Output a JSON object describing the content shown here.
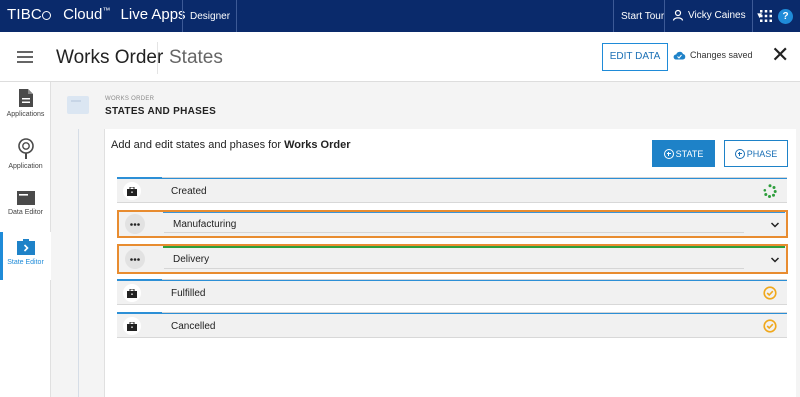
{
  "topbar": {
    "brand_tibco": "TIBC",
    "brand_cloud": "Cloud",
    "brand_tm": "™",
    "brand_app": "Live Apps",
    "designer_label": "Designer",
    "start_tour_label": "Start Tour",
    "user_name": "Vicky Caines",
    "help_label": "?"
  },
  "header": {
    "title": "Works Order",
    "subtitle": "States",
    "edit_data_label": "EDIT DATA",
    "save_status": "Changes saved",
    "close_label": "✕"
  },
  "sidebar": {
    "items": [
      {
        "label": "Applications",
        "icon": "document-icon"
      },
      {
        "label": "Application",
        "icon": "lightbulb-icon"
      },
      {
        "label": "Data Editor",
        "icon": "card-icon"
      },
      {
        "label": "State Editor",
        "icon": "state-icon"
      }
    ]
  },
  "content": {
    "eyebrow": "WORKS ORDER",
    "section_title": "STATES AND PHASES",
    "intro_prefix": "Add and edit states and phases for ",
    "intro_bold": "Works Order",
    "add_state_label": "STATE",
    "add_phase_label": "PHASE"
  },
  "rows": [
    {
      "name": "Created",
      "kind": "state",
      "status": "in-progress"
    },
    {
      "name": "Manufacturing",
      "kind": "phase",
      "status": "expand"
    },
    {
      "name": "Delivery",
      "kind": "phase",
      "status": "expand"
    },
    {
      "name": "Fulfilled",
      "kind": "state",
      "status": "complete"
    },
    {
      "name": "Cancelled",
      "kind": "state",
      "status": "complete"
    }
  ],
  "colors": {
    "navy": "#0a2a6b",
    "accent_blue": "#1e82c8",
    "phase_orange": "#e88c30",
    "check_yellow": "#f0a81c",
    "progress_green": "#2e9e3c"
  }
}
